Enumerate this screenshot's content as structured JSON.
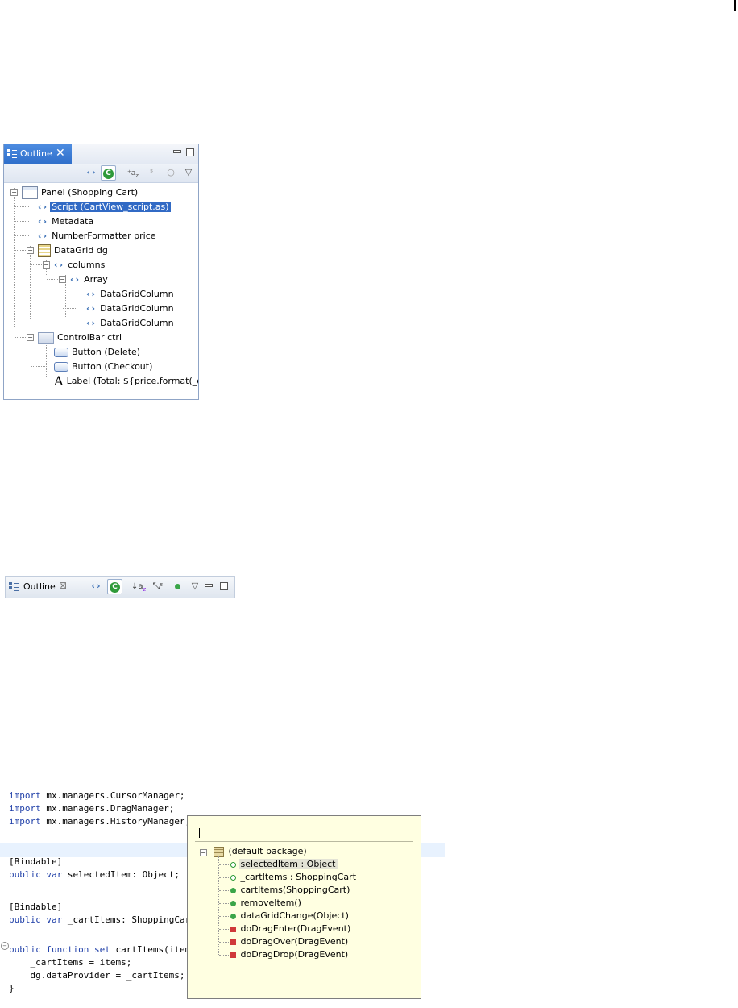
{
  "outline_panel": {
    "tab_label": "Outline",
    "toolbar_icons": [
      "show-mxml-icon",
      "show-classes-icon",
      "sort-icon",
      "hide-static-icon",
      "hide-nonpublic-icon",
      "view-menu-icon"
    ],
    "tree": [
      {
        "label": "Panel (Shopping Cart)",
        "icon": "panel-icon",
        "level": 0,
        "expanded": true
      },
      {
        "label": "Script (CartView_script.as)",
        "icon": "tag-icon",
        "level": 1,
        "selected": true
      },
      {
        "label": "Metadata",
        "icon": "tag-icon",
        "level": 1
      },
      {
        "label": "NumberFormatter price",
        "icon": "tag-icon",
        "level": 1
      },
      {
        "label": "DataGrid dg",
        "icon": "datagrid-icon",
        "level": 1,
        "expanded": true
      },
      {
        "label": "columns",
        "icon": "tag-icon",
        "level": 2,
        "expanded": true
      },
      {
        "label": "Array",
        "icon": "tag-icon",
        "level": 3,
        "expanded": true
      },
      {
        "label": "DataGridColumn",
        "icon": "tag-icon",
        "level": 4
      },
      {
        "label": "DataGridColumn",
        "icon": "tag-icon",
        "level": 4
      },
      {
        "label": "DataGridColumn",
        "icon": "tag-icon",
        "level": 4
      },
      {
        "label": "ControlBar ctrl",
        "icon": "controlbar-icon",
        "level": 1,
        "expanded": true
      },
      {
        "label": "Button (Delete)",
        "icon": "button-icon",
        "level": 2
      },
      {
        "label": "Button (Checkout)",
        "icon": "button-icon",
        "level": 2
      },
      {
        "label": "Label (Total: ${price.format(_ca",
        "icon": "label-icon",
        "level": 2
      }
    ]
  },
  "outline_toolbar": {
    "tab_label": "Outline"
  },
  "code_editor": {
    "lines": [
      [
        "kw:import",
        " mx.managers.CursorManager;"
      ],
      [
        "kw:import",
        " mx.managers.DragManager;"
      ],
      [
        "kw:import",
        " mx.managers.HistoryManager;"
      ],
      [],
      [
        "",
        "[Bindable]"
      ],
      [
        "kw:public",
        " ",
        "kw:var",
        " selectedItem: Object;"
      ],
      [],
      [
        "",
        "[Bindable]"
      ],
      [
        "kw:public",
        " ",
        "kw:var",
        " _cartItems: ShoppingCart;"
      ],
      [],
      [
        "kw:public",
        " ",
        "kw:function",
        " ",
        "kw:set",
        " cartItems(items:ShoppingCart):void {"
      ],
      [
        "",
        "    _cartItems = items;"
      ],
      [
        "",
        "    dg.dataProvider = _cartItems;"
      ],
      [
        "",
        "}"
      ]
    ]
  },
  "quick_outline": {
    "filter_value": "",
    "package_label": "(default package)",
    "items": [
      {
        "label": "selectedItem : Object",
        "kind": "var",
        "selected": true
      },
      {
        "label": "_cartItems : ShoppingCart",
        "kind": "var"
      },
      {
        "label": "cartItems(ShoppingCart)",
        "kind": "public-method"
      },
      {
        "label": "removeItem()",
        "kind": "public-method"
      },
      {
        "label": "dataGridChange(Object)",
        "kind": "public-method"
      },
      {
        "label": "doDragEnter(DragEvent)",
        "kind": "private-method"
      },
      {
        "label": "doDragOver(DragEvent)",
        "kind": "private-method"
      },
      {
        "label": "doDragDrop(DragEvent)",
        "kind": "private-method"
      }
    ]
  }
}
